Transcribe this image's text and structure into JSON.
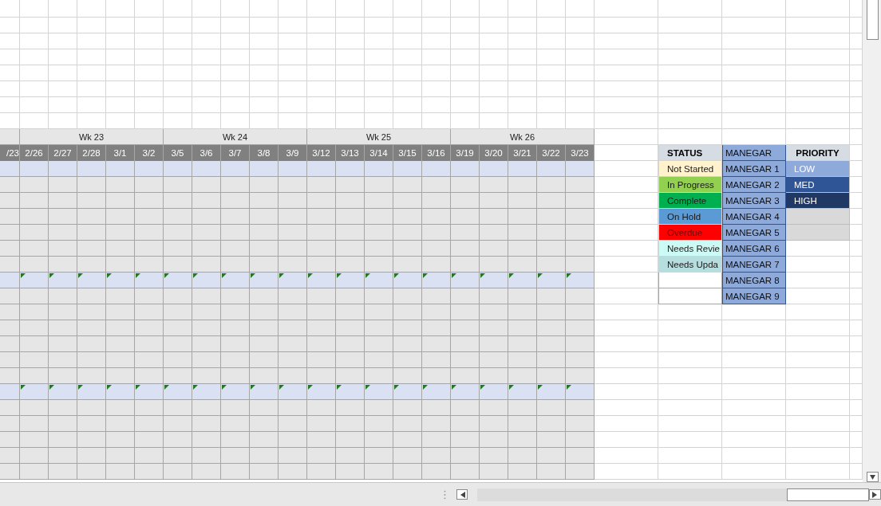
{
  "gantt": {
    "weeks": [
      {
        "label": "Wk 23"
      },
      {
        "label": "Wk 24"
      },
      {
        "label": "Wk 25"
      },
      {
        "label": "Wk 26"
      }
    ],
    "dates": [
      "/23",
      "2/26",
      "2/27",
      "2/28",
      "3/1",
      "3/2",
      "3/5",
      "3/6",
      "3/7",
      "3/8",
      "3/9",
      "3/12",
      "3/13",
      "3/14",
      "3/15",
      "3/16",
      "3/19",
      "3/20",
      "3/21",
      "3/22",
      "3/23"
    ],
    "rows": [
      {
        "kind": "band",
        "flagged": false
      },
      {
        "kind": "task",
        "flagged": false
      },
      {
        "kind": "task",
        "flagged": false
      },
      {
        "kind": "task",
        "flagged": false
      },
      {
        "kind": "task",
        "flagged": false
      },
      {
        "kind": "task",
        "flagged": false
      },
      {
        "kind": "task",
        "flagged": false
      },
      {
        "kind": "band",
        "flagged": true
      },
      {
        "kind": "task",
        "flagged": false
      },
      {
        "kind": "task",
        "flagged": false
      },
      {
        "kind": "task",
        "flagged": false
      },
      {
        "kind": "task",
        "flagged": false
      },
      {
        "kind": "task",
        "flagged": false
      },
      {
        "kind": "task",
        "flagged": false
      },
      {
        "kind": "band",
        "flagged": true
      },
      {
        "kind": "task",
        "flagged": false
      },
      {
        "kind": "task",
        "flagged": false
      },
      {
        "kind": "task",
        "flagged": false
      },
      {
        "kind": "task",
        "flagged": false
      },
      {
        "kind": "task",
        "flagged": false
      }
    ]
  },
  "legend": {
    "status": {
      "header": "STATUS",
      "items": [
        {
          "label": "Not Started",
          "color": "#fff2cc"
        },
        {
          "label": "In Progress",
          "color": "#92d050"
        },
        {
          "label": "Complete",
          "color": "#00b050"
        },
        {
          "label": "On Hold",
          "color": "#5b9bd5"
        },
        {
          "label": "Overdue",
          "color": "#ff0000"
        },
        {
          "label": "Needs Revie",
          "color": "#ccfbf5"
        },
        {
          "label": "Needs Upda",
          "color": "#b7dede"
        }
      ]
    },
    "managers": {
      "header": "MANEGAR",
      "items": [
        "MANEGAR 1",
        "MANEGAR 2",
        "MANEGAR 3",
        "MANEGAR 4",
        "MANEGAR 5",
        "MANEGAR 6",
        "MANEGAR 7",
        "MANEGAR 8",
        "MANEGAR 9"
      ]
    },
    "priority": {
      "header": "PRIORITY",
      "items": [
        {
          "label": "LOW",
          "color": "#8eaadb"
        },
        {
          "label": "MED",
          "color": "#2f5597"
        },
        {
          "label": "HIGH",
          "color": "#1f3864"
        },
        {
          "color": "#d9d9d9"
        },
        {
          "color": "#d9d9d9"
        }
      ]
    }
  }
}
